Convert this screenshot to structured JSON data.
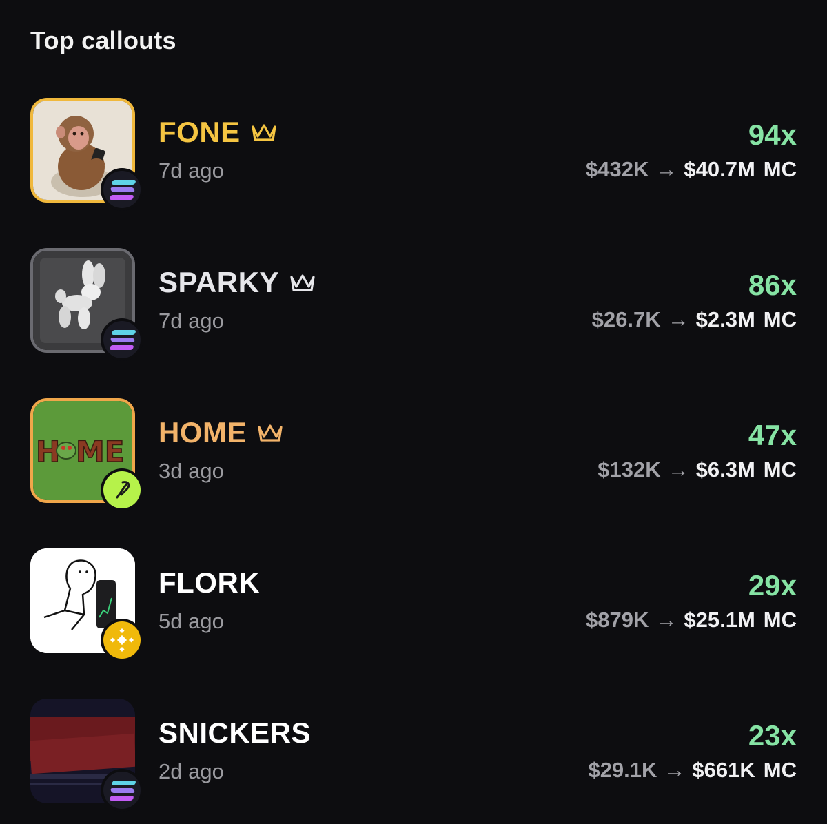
{
  "title": "Top callouts",
  "arrow": "→",
  "callouts": [
    {
      "name": "FONE",
      "ago": "7d ago",
      "multiplier": "94x",
      "from": "$432K",
      "to": "$40.7M",
      "unit": "MC",
      "name_color": "#f5c542",
      "crown": true,
      "crown_color": "#f5c542",
      "chain": "solana-icon",
      "border_color": "#f0b83c"
    },
    {
      "name": "SPARKY",
      "ago": "7d ago",
      "multiplier": "86x",
      "from": "$26.7K",
      "to": "$2.3M",
      "unit": "MC",
      "name_color": "#e6e6ea",
      "crown": true,
      "crown_color": "#e6e6ea",
      "chain": "solana-icon",
      "border_color": "#6a6a70"
    },
    {
      "name": "HOME",
      "ago": "3d ago",
      "multiplier": "47x",
      "from": "$132K",
      "to": "$6.3M",
      "unit": "MC",
      "name_color": "#f2b36a",
      "crown": true,
      "crown_color": "#f2b36a",
      "chain": "pump-icon",
      "border_color": "#f0a64a"
    },
    {
      "name": "FLORK",
      "ago": "5d ago",
      "multiplier": "29x",
      "from": "$879K",
      "to": "$25.1M",
      "unit": "MC",
      "name_color": "#ffffff",
      "crown": false,
      "chain": "bnb-icon",
      "border_color": "#ffffff"
    },
    {
      "name": "SNICKERS",
      "ago": "2d ago",
      "multiplier": "23x",
      "from": "$29.1K",
      "to": "$661K",
      "unit": "MC",
      "name_color": "#ffffff",
      "crown": false,
      "chain": "solana-icon",
      "border_color": "#1a1420"
    }
  ],
  "colors": {
    "background": "#0d0d10",
    "multiplier_green": "#86e3a4",
    "muted": "#9a9a9f"
  }
}
